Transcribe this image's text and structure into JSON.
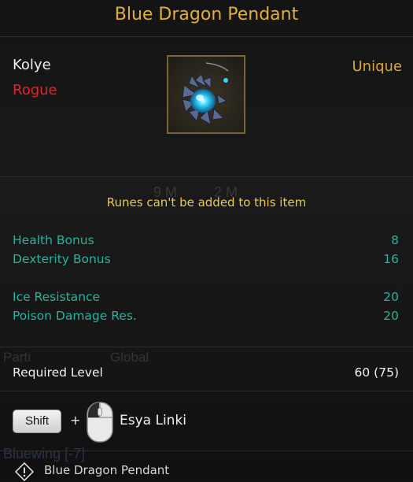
{
  "item": {
    "name": "Blue Dragon Pendant",
    "type": "Kolye",
    "class": "Rogue",
    "rarity": "Unique",
    "rune_note": "Runes can't be added to this item"
  },
  "stats": [
    {
      "label": "Health Bonus",
      "value": "8"
    },
    {
      "label": "Dexterity Bonus",
      "value": "16"
    },
    {
      "label": "Ice Resistance",
      "value": "20"
    },
    {
      "label": "Poison Damage Res.",
      "value": "20"
    }
  ],
  "requirements": {
    "label": "Required Level",
    "value": "60 (75)"
  },
  "link_hint": {
    "key": "Shift",
    "plus": "+",
    "label": "Esya Linki"
  },
  "footer": {
    "label": "Blue Dragon Pendant"
  },
  "background_ghost_text": {
    "a": "9 M",
    "b": "2 M",
    "c": "Parti",
    "d": "Global",
    "e": "Bluewing [-7]"
  },
  "colors": {
    "title": "#e3ae3a",
    "rarity": "#d9a73a",
    "class": "#e0262c",
    "stat": "#2ab2a0",
    "note": "#e8c95a"
  },
  "icons": {
    "item_icon": "pendant-icon",
    "mouse": "mouse-left-click-icon",
    "info": "info-icon"
  }
}
